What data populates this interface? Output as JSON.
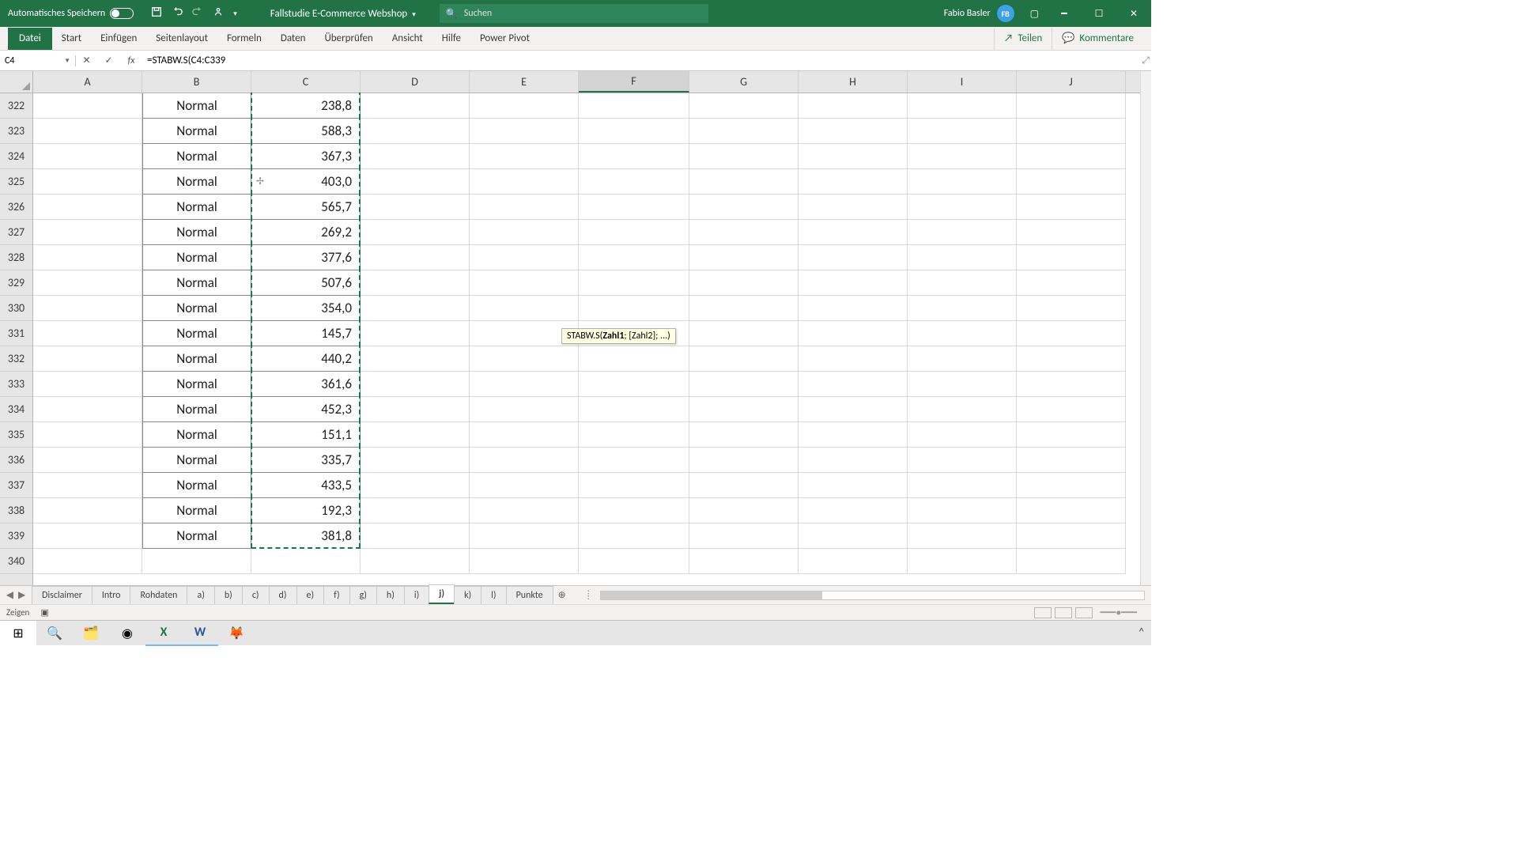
{
  "titlebar": {
    "autosave_label": "Automatisches Speichern",
    "doc_name": "Fallstudie E-Commerce Webshop",
    "search_placeholder": "Suchen",
    "user_name": "Fabio Basler",
    "user_initials": "FB"
  },
  "ribbon": {
    "tabs": [
      "Datei",
      "Start",
      "Einfügen",
      "Seitenlayout",
      "Formeln",
      "Daten",
      "Überprüfen",
      "Ansicht",
      "Hilfe",
      "Power Pivot"
    ],
    "share": "Teilen",
    "comments": "Kommentare"
  },
  "formula": {
    "name_box": "C4",
    "formula_text": "=STABW.S(C4:C339"
  },
  "columns": [
    "A",
    "B",
    "C",
    "D",
    "E",
    "F",
    "G",
    "H",
    "I",
    "J"
  ],
  "active_column": "F",
  "rows": [
    {
      "n": "322",
      "b": "Normal",
      "c": "238,8"
    },
    {
      "n": "323",
      "b": "Normal",
      "c": "588,3"
    },
    {
      "n": "324",
      "b": "Normal",
      "c": "367,3"
    },
    {
      "n": "325",
      "b": "Normal",
      "c": "403,0",
      "cursor": true
    },
    {
      "n": "326",
      "b": "Normal",
      "c": "565,7"
    },
    {
      "n": "327",
      "b": "Normal",
      "c": "269,2"
    },
    {
      "n": "328",
      "b": "Normal",
      "c": "377,6"
    },
    {
      "n": "329",
      "b": "Normal",
      "c": "507,6"
    },
    {
      "n": "330",
      "b": "Normal",
      "c": "354,0"
    },
    {
      "n": "331",
      "b": "Normal",
      "c": "145,7"
    },
    {
      "n": "332",
      "b": "Normal",
      "c": "440,2"
    },
    {
      "n": "333",
      "b": "Normal",
      "c": "361,6"
    },
    {
      "n": "334",
      "b": "Normal",
      "c": "452,3"
    },
    {
      "n": "335",
      "b": "Normal",
      "c": "151,1"
    },
    {
      "n": "336",
      "b": "Normal",
      "c": "335,7"
    },
    {
      "n": "337",
      "b": "Normal",
      "c": "433,5"
    },
    {
      "n": "338",
      "b": "Normal",
      "c": "192,3"
    },
    {
      "n": "339",
      "b": "Normal",
      "c": "381,8"
    },
    {
      "n": "340",
      "b": "",
      "c": ""
    }
  ],
  "tooltip": {
    "fn": "STABW.S(",
    "arg1": "Zahl1",
    "rest": "; [Zahl2]; ...)"
  },
  "sheets": [
    "Disclaimer",
    "Intro",
    "Rohdaten",
    "a)",
    "b)",
    "c)",
    "d)",
    "e)",
    "f)",
    "g)",
    "h)",
    "i)",
    "j)",
    "k)",
    "l)",
    "Punkte"
  ],
  "active_sheet": "j)",
  "status": {
    "mode": "Zeigen"
  }
}
